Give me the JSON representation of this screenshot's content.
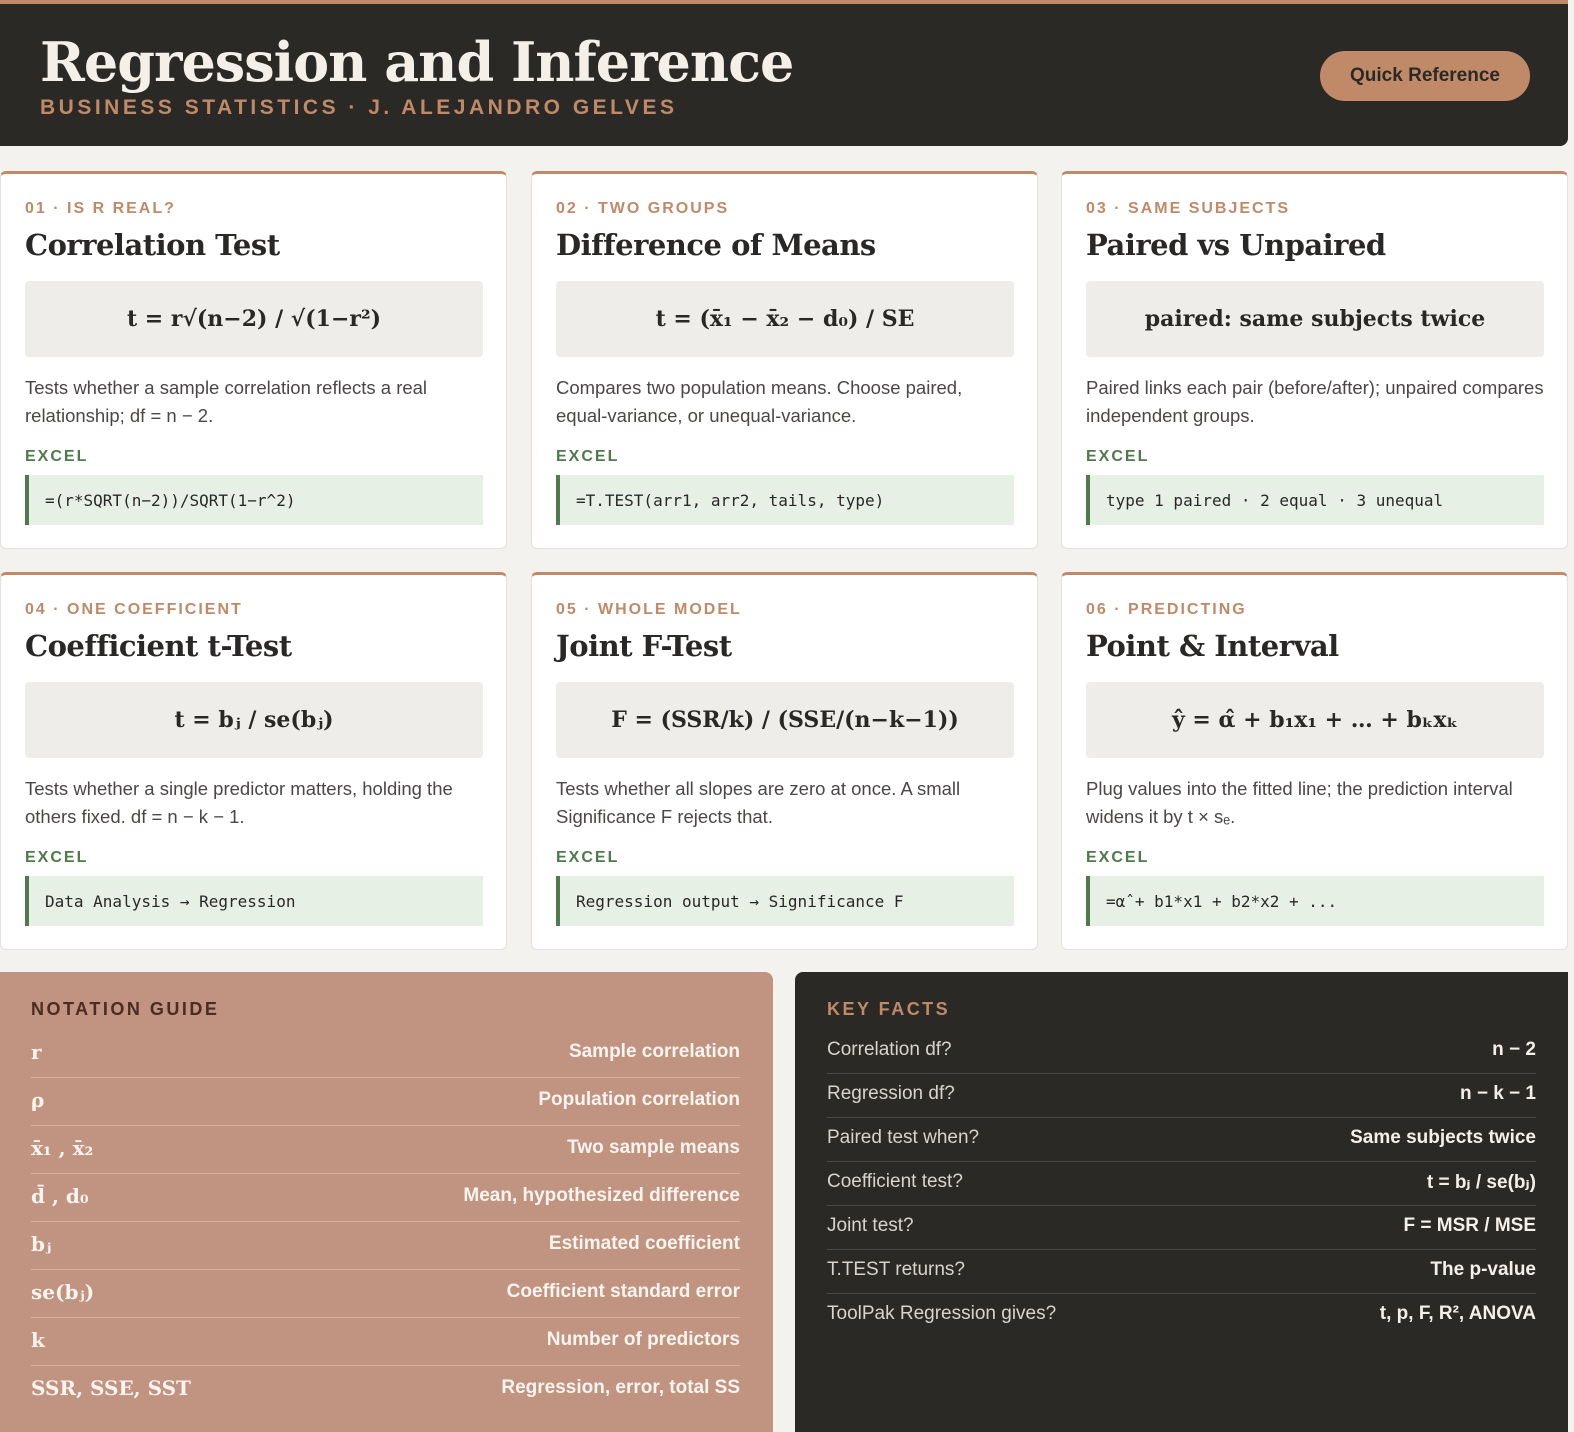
{
  "header": {
    "title": "Regression and Inference",
    "subtitle": "BUSINESS STATISTICS · J. ALEJANDRO GELVES",
    "quick_reference_label": "Quick Reference"
  },
  "cards": [
    {
      "kicker": "01 · IS R REAL?",
      "title": "Correlation Test",
      "formula": "t = r√(n−2) / √(1−r²)",
      "description": "Tests whether a sample correlation reflects a real relationship; df = n − 2.",
      "excel_label": "EXCEL",
      "excel": "=(r*SQRT(n−2))/SQRT(1−r^2)"
    },
    {
      "kicker": "02 · TWO GROUPS",
      "title": "Difference of Means",
      "formula": "t = (x̄₁ − x̄₂ − d₀) / SE",
      "description": "Compares two population means. Choose paired, equal-variance, or unequal-variance.",
      "excel_label": "EXCEL",
      "excel": "=T.TEST(arr1, arr2, tails, type)"
    },
    {
      "kicker": "03 · SAME SUBJECTS",
      "title": "Paired vs Unpaired",
      "formula": "paired: same subjects twice",
      "description": "Paired links each pair (before/after); unpaired compares independent groups.",
      "excel_label": "EXCEL",
      "excel": "type 1 paired · 2 equal · 3 unequal"
    },
    {
      "kicker": "04 · ONE COEFFICIENT",
      "title": "Coefficient t-Test",
      "formula": "t = bⱼ / se(bⱼ)",
      "description": "Tests whether a single predictor matters, holding the others fixed. df = n − k − 1.",
      "excel_label": "EXCEL",
      "excel": "Data Analysis → Regression"
    },
    {
      "kicker": "05 · WHOLE MODEL",
      "title": "Joint F-Test",
      "formula": "F = (SSR/k) / (SSE/(n−k−1))",
      "description": "Tests whether all slopes are zero at once. A small Significance F rejects that.",
      "excel_label": "EXCEL",
      "excel": "Regression output → Significance F"
    },
    {
      "kicker": "06 · PREDICTING",
      "title": "Point & Interval",
      "formula": "ŷ = α̂ + b₁x₁ + … + bₖxₖ",
      "description": "Plug values into the fitted line; the prediction interval widens it by t × sₑ.",
      "excel_label": "EXCEL",
      "excel": "=α̂ + b1*x1 + b2*x2 + ..."
    }
  ],
  "notation": {
    "title": "NOTATION GUIDE",
    "rows": [
      {
        "symbol": "r",
        "meaning": "Sample correlation"
      },
      {
        "symbol": "ρ",
        "meaning": "Population correlation"
      },
      {
        "symbol": "x̄₁ , x̄₂",
        "meaning": "Two sample means"
      },
      {
        "symbol": "d̄ , d₀",
        "meaning": "Mean, hypothesized difference"
      },
      {
        "symbol": "bⱼ",
        "meaning": "Estimated coefficient"
      },
      {
        "symbol": "se(bⱼ)",
        "meaning": "Coefficient standard error"
      },
      {
        "symbol": "k",
        "meaning": "Number of predictors"
      },
      {
        "symbol": "SSR, SSE, SST",
        "meaning": "Regression, error, total SS"
      }
    ]
  },
  "key_facts": {
    "title": "KEY FACTS",
    "rows": [
      {
        "question": "Correlation df?",
        "answer": "n − 2"
      },
      {
        "question": "Regression df?",
        "answer": "n − k − 1"
      },
      {
        "question": "Paired test when?",
        "answer": "Same subjects twice"
      },
      {
        "question": "Coefficient test?",
        "answer": "t = bⱼ / se(bⱼ)"
      },
      {
        "question": "Joint test?",
        "answer": "F = MSR / MSE"
      },
      {
        "question": "T.TEST returns?",
        "answer": "The p-value"
      },
      {
        "question": "ToolPak Regression gives?",
        "answer": "t, p, F, R², ANOVA"
      }
    ]
  },
  "colors": {
    "accent": "#c08a68",
    "dark": "#2b2926",
    "excel_green": "#4e7a4c",
    "notation_bg": "#c09480"
  }
}
